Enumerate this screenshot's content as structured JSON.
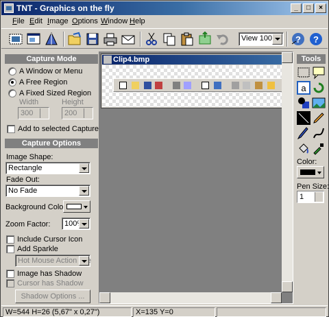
{
  "window": {
    "title": "TNT - Graphics on the fly"
  },
  "menu": [
    "File",
    "Edit",
    "Image",
    "Options",
    "Window",
    "Help"
  ],
  "toolbar": {
    "icons": [
      "capture-window-icon",
      "capture-region-icon",
      "capture-fixed-icon",
      "open-icon",
      "save-icon",
      "print-icon",
      "email-icon",
      "cut-icon",
      "copy-icon",
      "paste-icon",
      "resize-icon",
      "undo-icon",
      "whats-this-icon",
      "help-icon"
    ],
    "zoom_value": "View 100%"
  },
  "capture_mode": {
    "header": "Capture Mode",
    "options": [
      {
        "label": "A Window or Menu",
        "selected": false
      },
      {
        "label": "A Free Region",
        "selected": true
      },
      {
        "label": "A Fixed Sized Region",
        "selected": false
      }
    ],
    "width_label": "Width",
    "height_label": "Height",
    "width_value": "300",
    "height_value": "200",
    "add_to_selected": "Add to selected Capture"
  },
  "capture_options": {
    "header": "Capture Options",
    "image_shape_label": "Image Shape:",
    "image_shape_value": "Rectangle",
    "fade_out_label": "Fade Out:",
    "fade_out_value": "No Fade",
    "background_color_label": "Background Color:",
    "background_color": "#ffffff",
    "zoom_factor_label": "Zoom Factor:",
    "zoom_factor_value": "100%",
    "include_cursor": "Include Cursor Icon",
    "add_sparkle": "Add Sparkle",
    "sparkle_value": "Hot Mouse Action (Re",
    "image_shadow": "Image has Shadow",
    "cursor_shadow": "Cursor has Shadow",
    "shadow_options": "Shadow Options ..."
  },
  "document": {
    "title": "Clip4.bmp"
  },
  "tools": {
    "header": "Tools",
    "color_label": "Color:",
    "color_value": "#000000",
    "pen_size_label": "Pen Size:",
    "pen_size_value": "1"
  },
  "status": {
    "size": "W=544  H=26  (5,67\" x 0,27\")",
    "coords": "X=135  Y=0"
  },
  "colors": {
    "title_start": "#0a246a",
    "title_end": "#a6caf0",
    "face": "#d4d0c8"
  }
}
